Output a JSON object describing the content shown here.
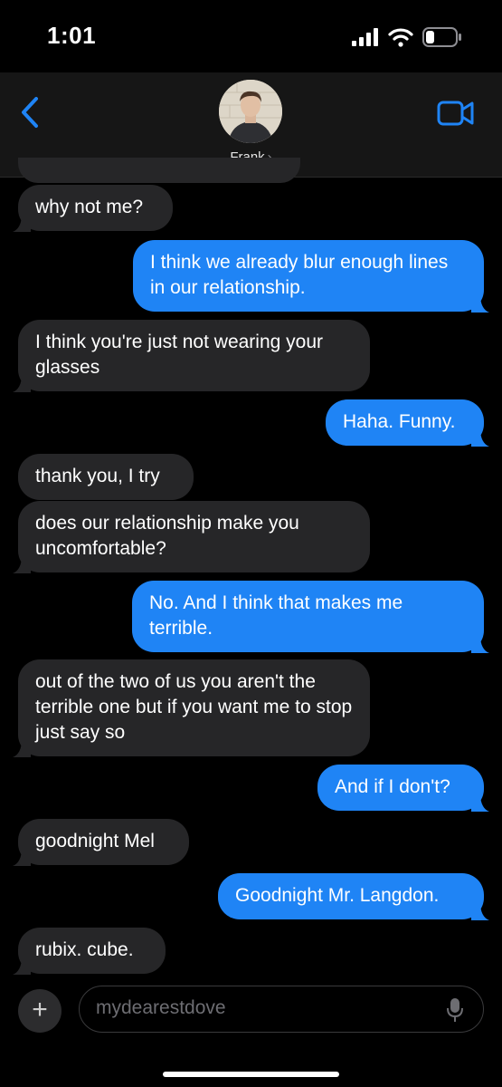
{
  "status": {
    "time": "1:01"
  },
  "contact": {
    "name": "Frank",
    "chevron": "›"
  },
  "messages": [
    {
      "dir": "recv",
      "text": "why not me?"
    },
    {
      "dir": "sent",
      "text": "I think we already blur enough lines in our relationship."
    },
    {
      "dir": "recv",
      "text": "I think you're just not wearing your glasses"
    },
    {
      "dir": "sent",
      "text": "Haha. Funny."
    },
    {
      "dir": "recv",
      "text": "thank you, I try"
    },
    {
      "dir": "recv",
      "text": "does our relationship make you uncomfortable?"
    },
    {
      "dir": "sent",
      "text": "No. And I think that makes me terrible."
    },
    {
      "dir": "recv",
      "text": "out of the two of us you aren't the terrible one but if you want me to stop just say so"
    },
    {
      "dir": "sent",
      "text": "And if I don't?"
    },
    {
      "dir": "recv",
      "text": "goodnight Mel"
    },
    {
      "dir": "sent",
      "text": "Goodnight Mr. Langdon."
    },
    {
      "dir": "recv",
      "text": "rubix. cube."
    }
  ],
  "composer": {
    "plus": "+",
    "placeholder": "mydearestdove"
  },
  "colors": {
    "sent": "#1f84f5",
    "received": "#262628",
    "accent": "#1f84f5",
    "background": "#000000"
  },
  "icons": [
    "back-chevron-icon",
    "video-camera-icon",
    "signal-icon",
    "wifi-icon",
    "battery-icon",
    "plus-icon",
    "microphone-icon"
  ]
}
